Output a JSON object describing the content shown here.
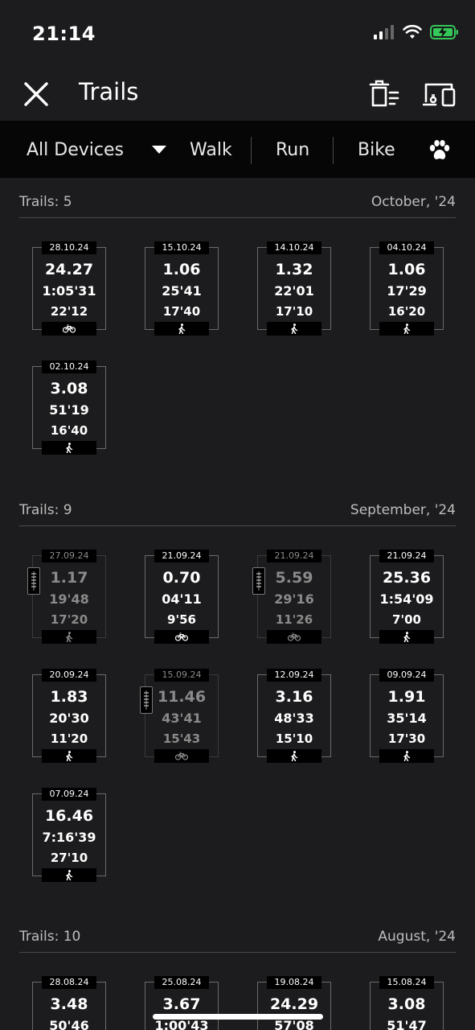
{
  "status_bar": {
    "time": "21:14"
  },
  "app_bar": {
    "title": "Trails"
  },
  "filters": {
    "device": "All Devices",
    "walk": "Walk",
    "run": "Run",
    "bike": "Bike"
  },
  "sections": [
    {
      "count": "Trails: 5",
      "month": "October, '24",
      "cards": [
        {
          "date": "28.10.24",
          "dist": "24.27",
          "dur": "1:05'31",
          "pace": "22'12",
          "type": "bike",
          "dim": false,
          "stack": false
        },
        {
          "date": "15.10.24",
          "dist": "1.06",
          "dur": "25'41",
          "pace": "17'40",
          "type": "walk",
          "dim": false,
          "stack": false
        },
        {
          "date": "14.10.24",
          "dist": "1.32",
          "dur": "22'01",
          "pace": "17'10",
          "type": "walk",
          "dim": false,
          "stack": false
        },
        {
          "date": "04.10.24",
          "dist": "1.06",
          "dur": "17'29",
          "pace": "16'20",
          "type": "walk",
          "dim": false,
          "stack": false
        },
        {
          "date": "02.10.24",
          "dist": "3.08",
          "dur": "51'19",
          "pace": "16'40",
          "type": "walk",
          "dim": false,
          "stack": false
        }
      ]
    },
    {
      "count": "Trails: 9",
      "month": "September, '24",
      "cards": [
        {
          "date": "27.09.24",
          "dist": "1.17",
          "dur": "19'48",
          "pace": "17'20",
          "type": "walk",
          "dim": true,
          "stack": true
        },
        {
          "date": "21.09.24",
          "dist": "0.70",
          "dur": "04'11",
          "pace": "9'56",
          "type": "bike",
          "dim": false,
          "stack": false
        },
        {
          "date": "21.09.24",
          "dist": "5.59",
          "dur": "29'16",
          "pace": "11'26",
          "type": "bike",
          "dim": true,
          "stack": true
        },
        {
          "date": "21.09.24",
          "dist": "25.36",
          "dur": "1:54'09",
          "pace": "7'00",
          "type": "walk",
          "dim": false,
          "stack": false
        },
        {
          "date": "20.09.24",
          "dist": "1.83",
          "dur": "20'30",
          "pace": "11'20",
          "type": "walk",
          "dim": false,
          "stack": false
        },
        {
          "date": "15.09.24",
          "dist": "11.46",
          "dur": "43'41",
          "pace": "15'43",
          "type": "bike",
          "dim": true,
          "stack": true
        },
        {
          "date": "12.09.24",
          "dist": "3.16",
          "dur": "48'33",
          "pace": "15'10",
          "type": "walk",
          "dim": false,
          "stack": false
        },
        {
          "date": "09.09.24",
          "dist": "1.91",
          "dur": "35'14",
          "pace": "17'30",
          "type": "walk",
          "dim": false,
          "stack": false
        },
        {
          "date": "07.09.24",
          "dist": "16.46",
          "dur": "7:16'39",
          "pace": "27'10",
          "type": "walk",
          "dim": false,
          "stack": false
        }
      ]
    },
    {
      "count": "Trails: 10",
      "month": "August, '24",
      "cards": [
        {
          "date": "28.08.24",
          "dist": "3.48",
          "dur": "50'46",
          "pace": "",
          "type": "walk",
          "dim": false,
          "stack": false
        },
        {
          "date": "25.08.24",
          "dist": "3.67",
          "dur": "1:00'43",
          "pace": "",
          "type": "walk",
          "dim": false,
          "stack": false
        },
        {
          "date": "19.08.24",
          "dist": "24.29",
          "dur": "57'08",
          "pace": "",
          "type": "walk",
          "dim": false,
          "stack": false
        },
        {
          "date": "15.08.24",
          "dist": "3.08",
          "dur": "51'47",
          "pace": "",
          "type": "walk",
          "dim": false,
          "stack": false
        }
      ]
    }
  ]
}
